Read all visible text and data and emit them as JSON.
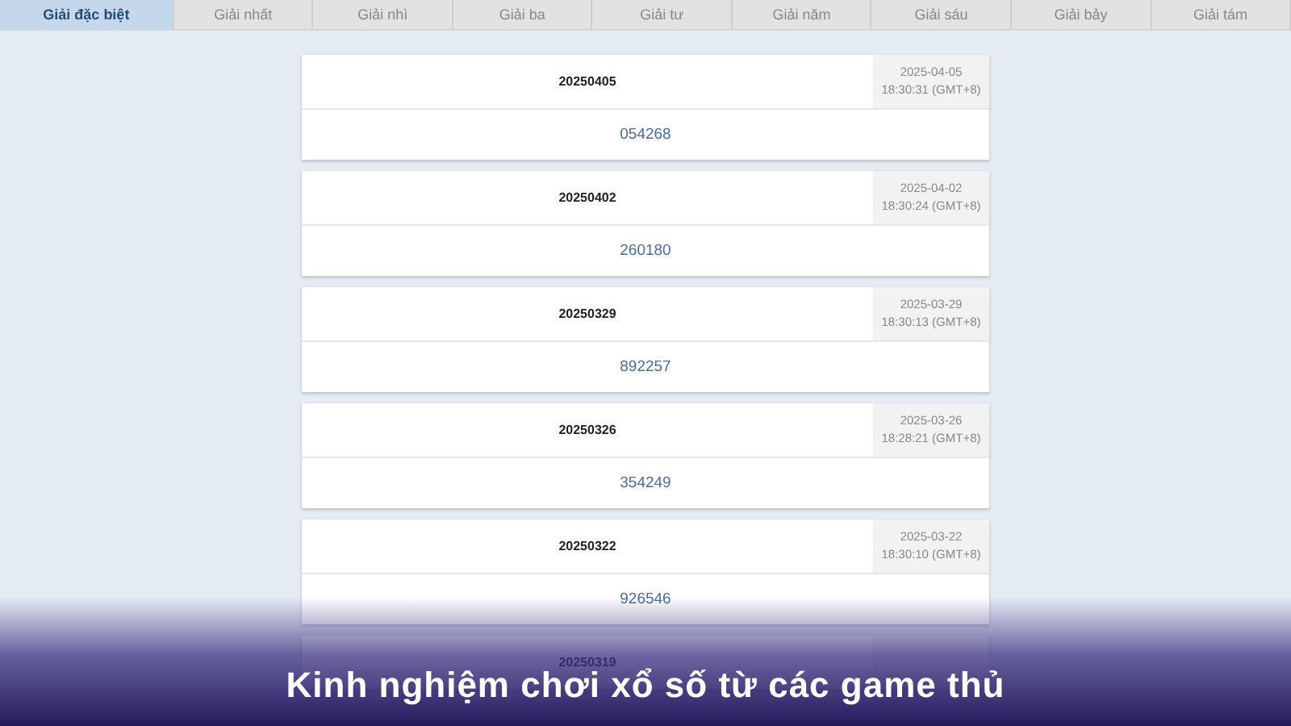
{
  "tabs": [
    {
      "label": "Giải đặc biệt",
      "selected": true
    },
    {
      "label": "Giải nhất",
      "selected": false
    },
    {
      "label": "Giải nhì",
      "selected": false
    },
    {
      "label": "Giải ba",
      "selected": false
    },
    {
      "label": "Giải tư",
      "selected": false
    },
    {
      "label": "Giải năm",
      "selected": false
    },
    {
      "label": "Giải sáu",
      "selected": false
    },
    {
      "label": "Giải bảy",
      "selected": false
    },
    {
      "label": "Giải tám",
      "selected": false
    }
  ],
  "draws": [
    {
      "issue": "20250405",
      "date": "2025-04-05",
      "time": "18:30:31 (GMT+8)",
      "result": "054268"
    },
    {
      "issue": "20250402",
      "date": "2025-04-02",
      "time": "18:30:24 (GMT+8)",
      "result": "260180"
    },
    {
      "issue": "20250329",
      "date": "2025-03-29",
      "time": "18:30:13 (GMT+8)",
      "result": "892257"
    },
    {
      "issue": "20250326",
      "date": "2025-03-26",
      "time": "18:28:21 (GMT+8)",
      "result": "354249"
    },
    {
      "issue": "20250322",
      "date": "2025-03-22",
      "time": "18:30:10 (GMT+8)",
      "result": "926546"
    },
    {
      "issue": "20250319"
    }
  ],
  "caption": "Kinh nghiệm chơi xổ số từ các game thủ"
}
